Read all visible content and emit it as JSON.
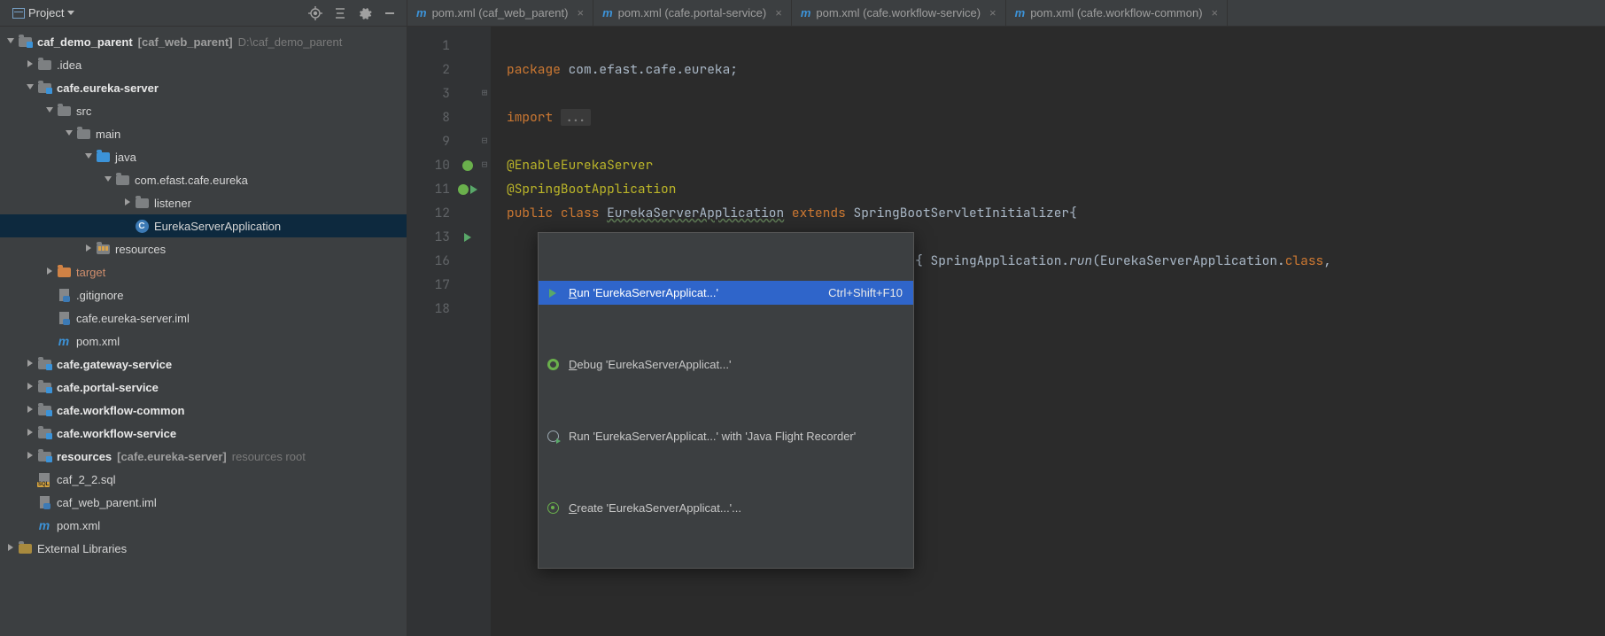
{
  "projectPanel": {
    "title": "Project",
    "root": {
      "name": "caf_demo_parent",
      "bracket": "[caf_web_parent]",
      "path": "D:\\caf_demo_parent"
    },
    "nodes": {
      "idea": ".idea",
      "eureka": "cafe.eureka-server",
      "src": "src",
      "main": "main",
      "java": "java",
      "pkg": "com.efast.cafe.eureka",
      "listener": "listener",
      "appClass": "EurekaServerApplication",
      "resources": "resources",
      "target": "target",
      "gitignore": ".gitignore",
      "iml1": "cafe.eureka-server.iml",
      "pom1": "pom.xml",
      "gateway": "cafe.gateway-service",
      "portal": "cafe.portal-service",
      "wfCommon": "cafe.workflow-common",
      "wfService": "cafe.workflow-service",
      "resMod": "resources",
      "resModBr": "[cafe.eureka-server]",
      "resModHint": "resources root",
      "sql": "caf_2_2.sql",
      "iml2": "caf_web_parent.iml",
      "pom2": "pom.xml",
      "extLibs": "External Libraries"
    }
  },
  "tabs": [
    {
      "label": "pom.xml (caf_web_parent)"
    },
    {
      "label": "pom.xml (cafe.portal-service)"
    },
    {
      "label": "pom.xml (cafe.workflow-service)"
    },
    {
      "label": "pom.xml (cafe.workflow-common)"
    }
  ],
  "editor": {
    "lineNumbers": [
      "1",
      "2",
      "3",
      "8",
      "9",
      "10",
      "11",
      "12",
      "13",
      "16",
      "17",
      "18"
    ],
    "code": {
      "l1_kw": "package",
      "l1_rest": " com.efast.cafe.eureka;",
      "l3_kw": "import",
      "l3_dim": "...",
      "l9": "@EnableEurekaServer",
      "l10": "@SpringBootApplication",
      "l11_kw1": "public",
      "l11_kw2": "class",
      "l11_name": "EurekaServerApplication",
      "l11_kw3": "extends",
      "l11_sup": "SpringBootServletInitializer{",
      "l13_tail_a": "args) { SpringApplication.",
      "l13_tail_b": "run",
      "l13_tail_c": "(EurekaServerApplication.",
      "l13_tail_d": "class",
      "l13_tail_e": ","
    }
  },
  "contextMenu": {
    "items": [
      {
        "label": "Run 'EurekaServerApplicat...'",
        "ul": "R",
        "shortcut": "Ctrl+Shift+F10"
      },
      {
        "label": "Debug 'EurekaServerApplicat...'",
        "ul": "D",
        "shortcut": ""
      },
      {
        "label": "Run 'EurekaServerApplicat...' with 'Java Flight Recorder'",
        "ul": "",
        "shortcut": ""
      },
      {
        "label": "Create 'EurekaServerApplicat...'...",
        "ul": "C",
        "shortcut": ""
      }
    ]
  }
}
